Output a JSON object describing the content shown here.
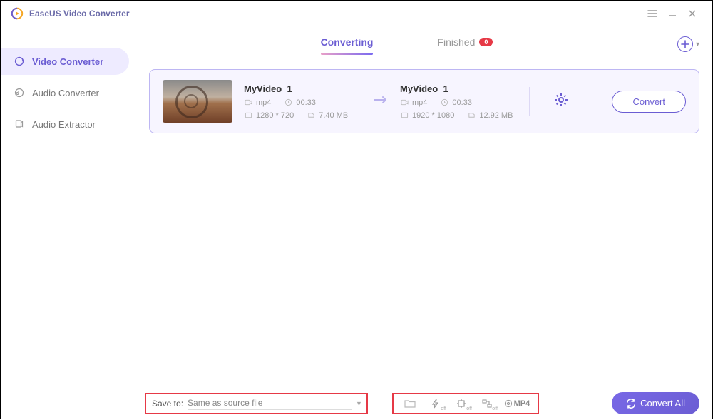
{
  "app_title": "EaseUS Video Converter",
  "sidebar": {
    "items": [
      {
        "label": "Video Converter"
      },
      {
        "label": "Audio Converter"
      },
      {
        "label": "Audio Extractor"
      }
    ]
  },
  "tabs": {
    "converting": "Converting",
    "finished": "Finished",
    "finished_badge": "0"
  },
  "item": {
    "source": {
      "name": "MyVideo_1",
      "format": "mp4",
      "duration": "00:33",
      "resolution": "1280 * 720",
      "size": "7.40 MB"
    },
    "target": {
      "name": "MyVideo_1",
      "format": "mp4",
      "duration": "00:33",
      "resolution": "1920 * 1080",
      "size": "12.92 MB"
    },
    "convert_label": "Convert"
  },
  "footer": {
    "save_to_label": "Save to:",
    "save_to_value": "Same as source file",
    "output_format": "MP4",
    "opt_off": "off",
    "convert_all": "Convert All"
  }
}
